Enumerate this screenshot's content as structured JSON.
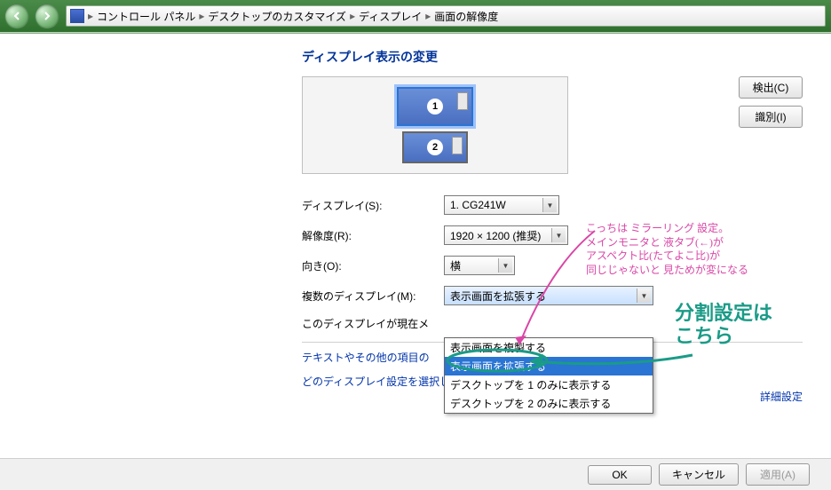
{
  "breadcrumb": {
    "items": [
      "コントロール パネル",
      "デスクトップのカスタマイズ",
      "ディスプレイ",
      "画面の解像度"
    ]
  },
  "page": {
    "title": "ディスプレイ表示の変更"
  },
  "side_buttons": {
    "detect": "検出(C)",
    "identify": "識別(I)"
  },
  "monitors": {
    "num1": "1",
    "num2": "2"
  },
  "form": {
    "display_label": "ディスプレイ(S):",
    "display_value": "1. CG241W",
    "resolution_label": "解像度(R):",
    "resolution_value": "1920 × 1200 (推奨)",
    "orientation_label": "向き(O):",
    "orientation_value": "横",
    "multi_label": "複数のディスプレイ(M):",
    "multi_value": "表示画面を拡張する",
    "current_text": "このディスプレイが現在メ"
  },
  "dropdown": {
    "items": [
      "表示画面を複製する",
      "表示画面を拡張する",
      "デスクトップを 1 のみに表示する",
      "デスクトップを 2 のみに表示する"
    ],
    "selected_index": 1
  },
  "links": {
    "text_items": "テキストやその他の項目の",
    "which_settings": "どのディスプレイ設定を選択しますか?",
    "advanced": "詳細設定"
  },
  "buttons": {
    "ok": "OK",
    "cancel": "キャンセル",
    "apply": "適用(A)"
  },
  "annotations": {
    "pink": "こっちは ミラーリング 設定。\nメインモニタと 液タブ(←)が\nアスペクト比(たてよこ比)が\n同じじゃないと 見ためが変になる",
    "teal": "分割設定は\n   こちら"
  }
}
